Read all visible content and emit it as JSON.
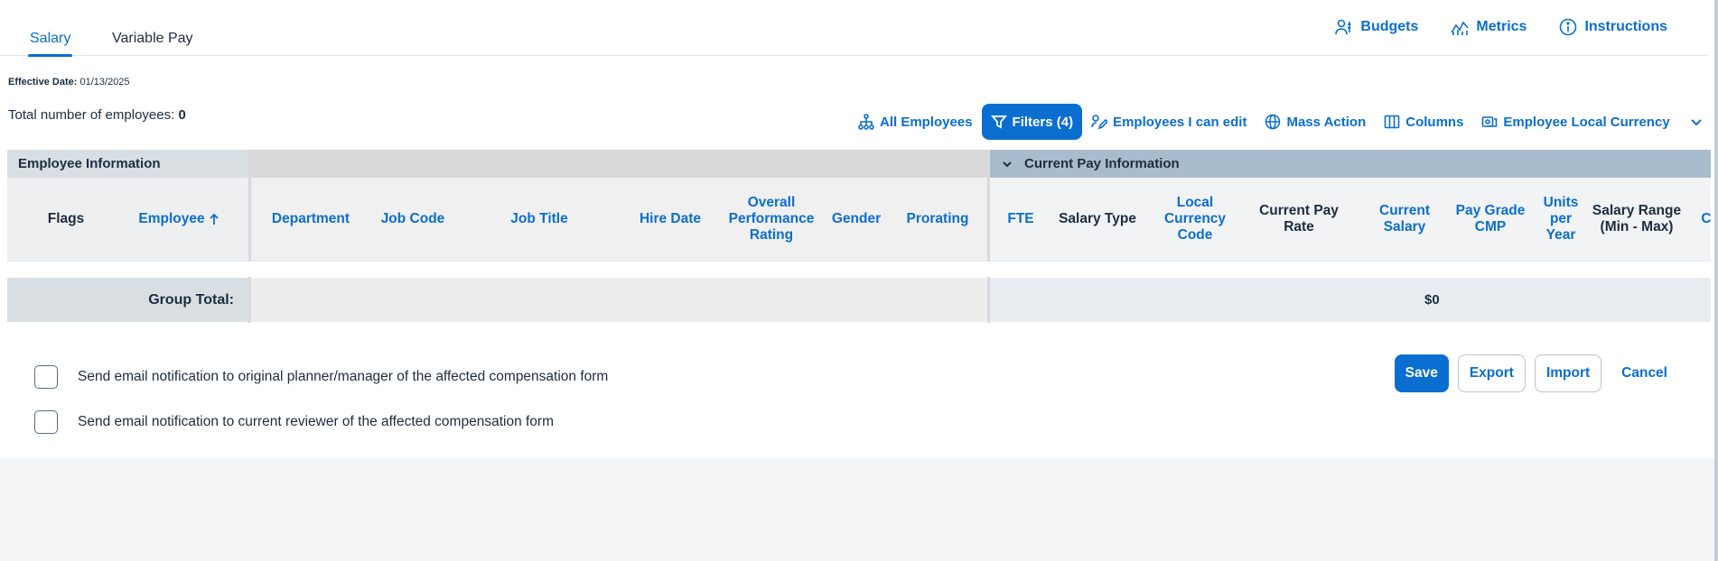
{
  "tabs": [
    {
      "label": "Salary",
      "active": true
    },
    {
      "label": "Variable Pay",
      "active": false
    }
  ],
  "toplinks": {
    "budgets": "Budgets",
    "metrics": "Metrics",
    "instructions": "Instructions"
  },
  "effective_date": {
    "label": "Effective Date:",
    "value": "01/13/2025"
  },
  "total_employees": {
    "label": "Total number of employees:",
    "value": "0"
  },
  "toolbar": {
    "all_employees": "All Employees",
    "filters": "Filters (4)",
    "employees_i_can_edit": "Employees I can edit",
    "mass_action": "Mass Action",
    "columns": "Columns",
    "employee_local_currency": "Employee Local Currency"
  },
  "table": {
    "group_headers": {
      "employee_information": "Employee Information",
      "current_pay_information": "Current Pay Information"
    },
    "columns": {
      "flags": "Flags",
      "employee": "Employee",
      "department": "Department",
      "job_code": "Job Code",
      "job_title": "Job Title",
      "hire_date": "Hire Date",
      "overall_performance_rating": "Overall Performance Rating",
      "gender": "Gender",
      "prorating": "Prorating",
      "fte": "FTE",
      "salary_type": "Salary Type",
      "local_currency_code": "Local Currency Code",
      "current_pay_rate": "Current Pay Rate",
      "current_salary": "Current Salary",
      "pay_grade_cmp": "Pay Grade CMP",
      "units_per_year": "Units per Year",
      "salary_range": "Salary Range (Min - Max)",
      "cut_off": "C"
    },
    "group_total": {
      "label": "Group Total:",
      "current_salary": "$0"
    }
  },
  "notifications": [
    {
      "label": "Send email notification to original planner/manager of the affected compensation form",
      "checked": false
    },
    {
      "label": "Send email notification to current reviewer of the affected compensation form",
      "checked": false
    }
  ],
  "actions": {
    "save": "Save",
    "export": "Export",
    "import": "Import",
    "cancel": "Cancel"
  },
  "colors": {
    "accent": "#0a6ed1",
    "group_header_pay": "#a9bccd"
  }
}
